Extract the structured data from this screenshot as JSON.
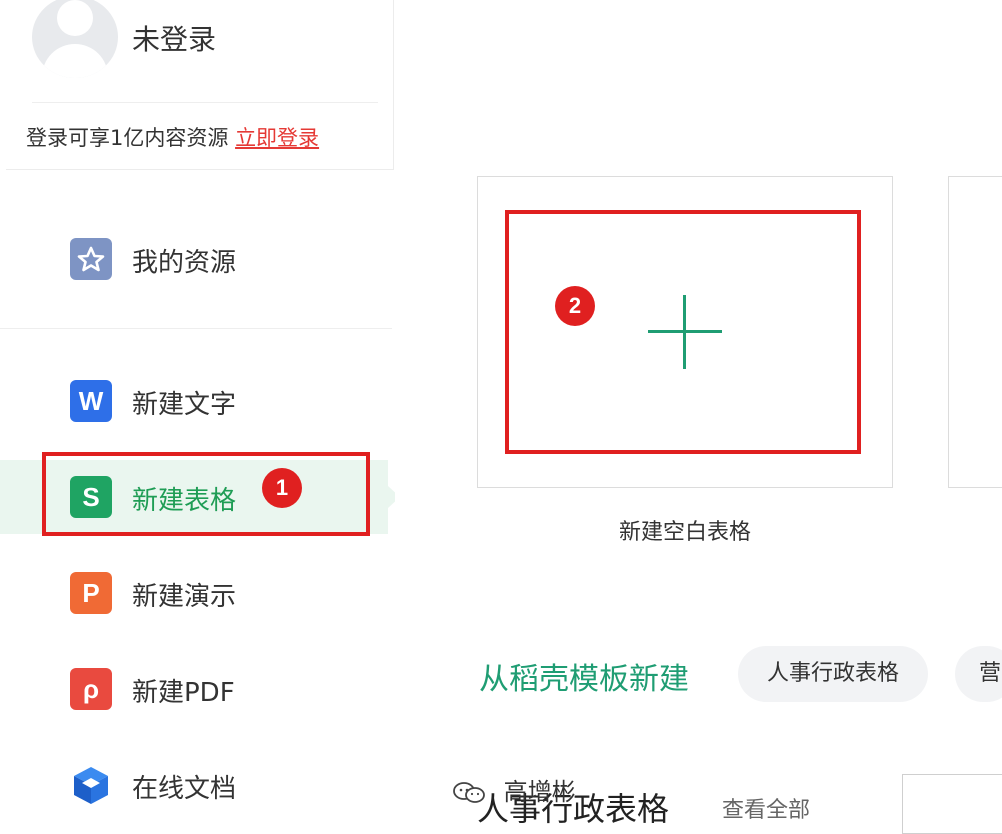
{
  "user": {
    "name": "未登录",
    "login_tip": "登录可享1亿内容资源",
    "login_link": "立即登录"
  },
  "menu": {
    "resources": {
      "label": "我的资源",
      "icon": "star-icon"
    },
    "items": [
      {
        "label": "新建文字",
        "icon": "wps-writer-icon",
        "glyph": "W",
        "color": "#2e6fe8"
      },
      {
        "label": "新建表格",
        "icon": "wps-spreadsheet-icon",
        "glyph": "S",
        "color": "#1fa463",
        "active": true
      },
      {
        "label": "新建演示",
        "icon": "wps-presentation-icon",
        "glyph": "P",
        "color": "#f06a35"
      },
      {
        "label": "新建PDF",
        "icon": "wps-pdf-icon",
        "glyph": "ρ",
        "color": "#e94a3f"
      },
      {
        "label": "在线文档",
        "icon": "online-doc-icon",
        "glyph": "",
        "color": "#1d6fe0"
      }
    ]
  },
  "annotations": {
    "badge1": "1",
    "badge2": "2"
  },
  "main": {
    "blank_card_caption": "新建空白表格",
    "template_heading": "从稻壳模板新建",
    "chips": [
      "人事行政表格",
      "营"
    ],
    "section_title": "人事行政表格",
    "view_all": "查看全部"
  },
  "watermark": {
    "text": "高增彬"
  },
  "colors": {
    "accent_green": "#1f9d73",
    "highlight_red": "#e02020",
    "active_bg": "#eaf6ef"
  }
}
